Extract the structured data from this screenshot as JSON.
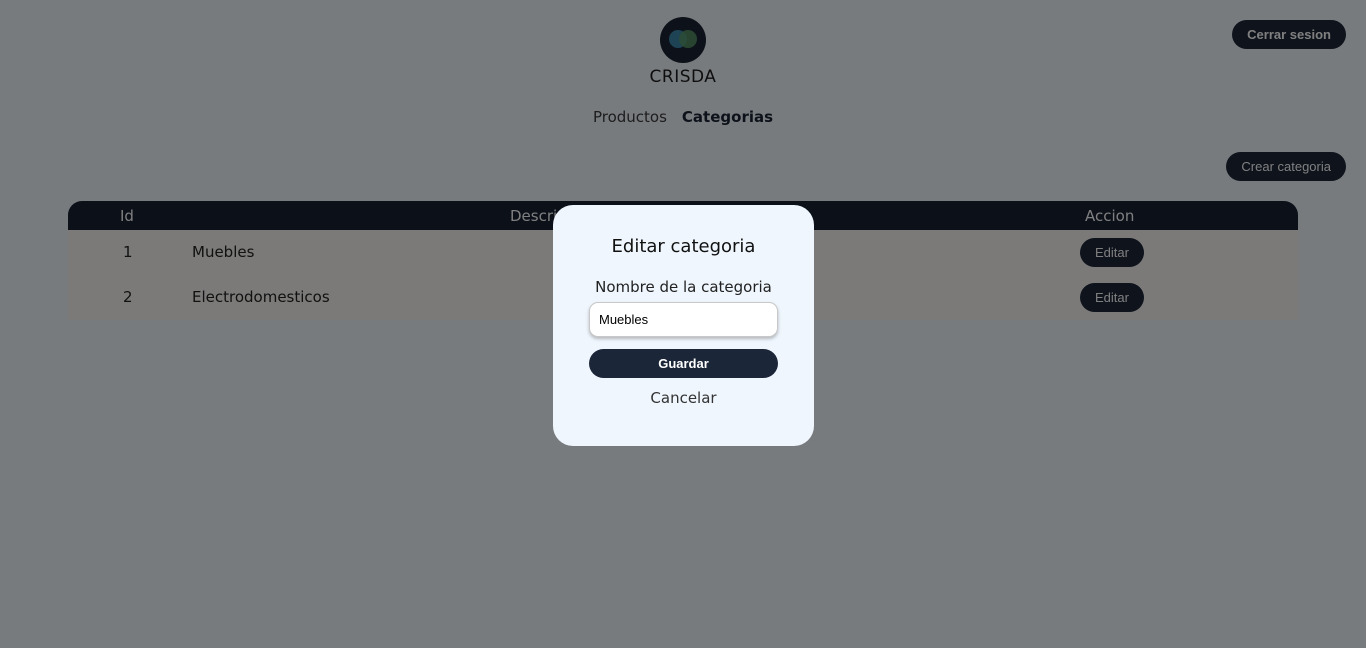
{
  "header": {
    "brand": "CRISDA",
    "logout_label": "Cerrar sesion"
  },
  "nav": {
    "items": [
      {
        "label": "Productos",
        "active": false
      },
      {
        "label": "Categorias",
        "active": true
      }
    ]
  },
  "toolbar": {
    "create_label": "Crear categoria"
  },
  "table": {
    "headers": [
      "Id",
      "Descripcion",
      "Accion"
    ],
    "rows": [
      {
        "id": "1",
        "description": "Muebles",
        "action": "Editar"
      },
      {
        "id": "2",
        "description": "Electrodomesticos",
        "action": "Editar"
      }
    ]
  },
  "modal": {
    "title": "Editar categoria",
    "field_label": "Nombre de la categoria",
    "field_value": "Muebles",
    "save_label": "Guardar",
    "cancel_label": "Cancelar"
  },
  "colors": {
    "primary": "#1c2639",
    "background": "#eff6fd"
  },
  "icons": {
    "logo": "brand-logo-icon"
  }
}
